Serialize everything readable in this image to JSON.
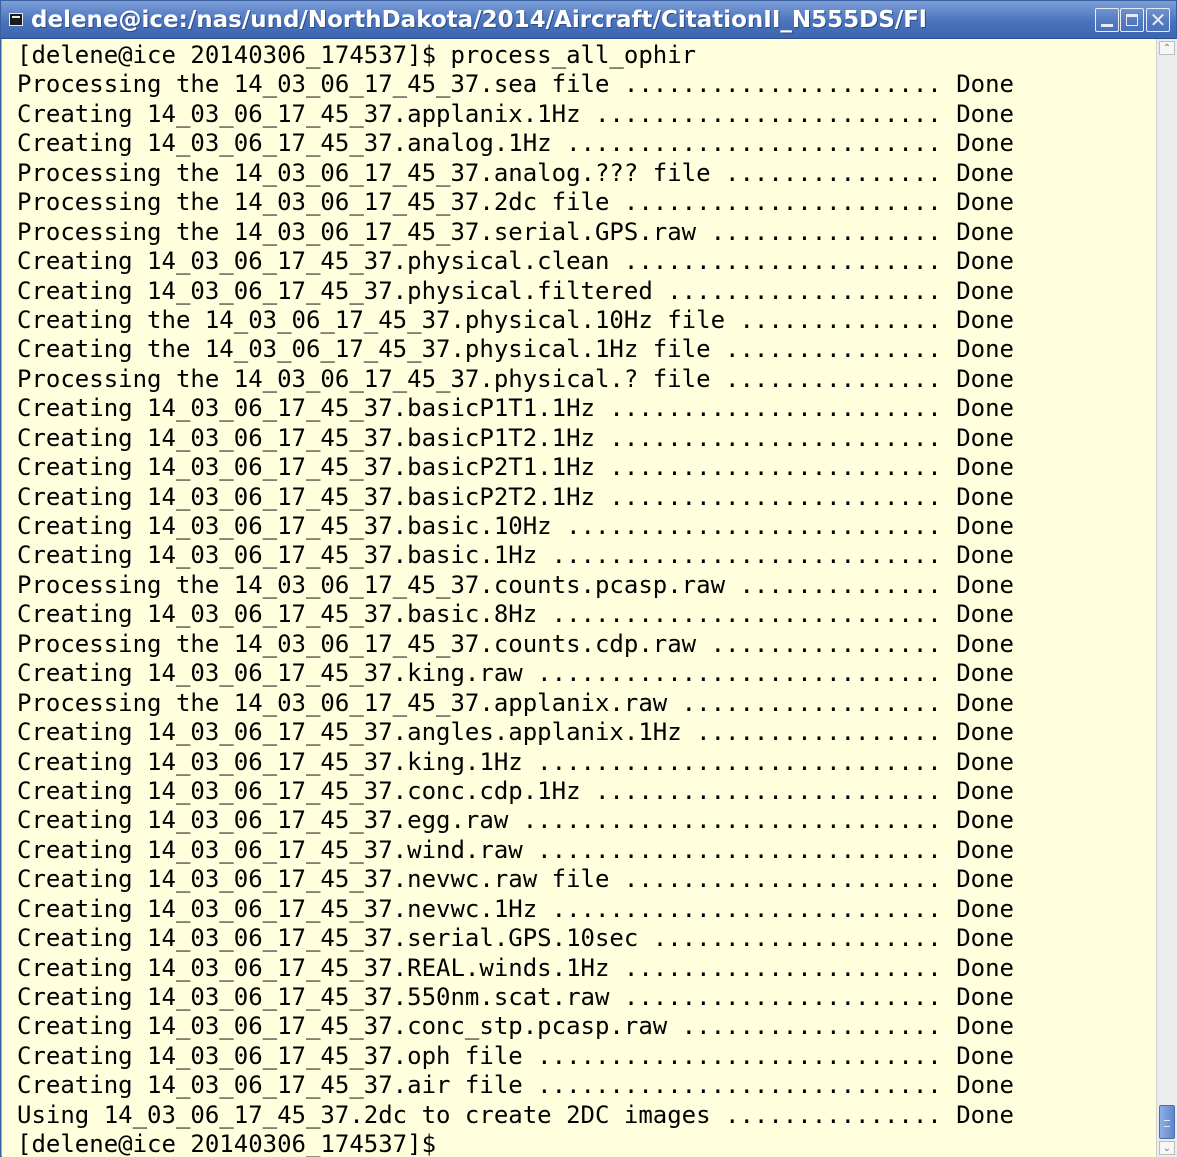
{
  "window": {
    "title": "delene@ice:/nas/und/NorthDakota/2014/Aircraft/CitationII_N555DS/Fl",
    "icon": "terminal-icon",
    "buttons": [
      "minimize-icon",
      "maximize-icon",
      "close-icon"
    ]
  },
  "terminal": {
    "background": "#ffffdd",
    "lines": [
      "[delene@ice 20140306_174537]$ process_all_ophir",
      "Processing the 14_03_06_17_45_37.sea file ...................... Done",
      "Creating 14_03_06_17_45_37.applanix.1Hz ........................ Done",
      "Creating 14_03_06_17_45_37.analog.1Hz .......................... Done",
      "Processing the 14_03_06_17_45_37.analog.??? file ............... Done",
      "Processing the 14_03_06_17_45_37.2dc file ...................... Done",
      "Processing the 14_03_06_17_45_37.serial.GPS.raw ................ Done",
      "Creating 14_03_06_17_45_37.physical.clean ...................... Done",
      "Creating 14_03_06_17_45_37.physical.filtered ................... Done",
      "Creating the 14_03_06_17_45_37.physical.10Hz file .............. Done",
      "Creating the 14_03_06_17_45_37.physical.1Hz file ............... Done",
      "Processing the 14_03_06_17_45_37.physical.? file ............... Done",
      "Creating 14_03_06_17_45_37.basicP1T1.1Hz ....................... Done",
      "Creating 14_03_06_17_45_37.basicP1T2.1Hz ....................... Done",
      "Creating 14_03_06_17_45_37.basicP2T1.1Hz ....................... Done",
      "Creating 14_03_06_17_45_37.basicP2T2.1Hz ....................... Done",
      "Creating 14_03_06_17_45_37.basic.10Hz .......................... Done",
      "Creating 14_03_06_17_45_37.basic.1Hz ........................... Done",
      "Processing the 14_03_06_17_45_37.counts.pcasp.raw .............. Done",
      "Creating 14_03_06_17_45_37.basic.8Hz ........................... Done",
      "Processing the 14_03_06_17_45_37.counts.cdp.raw ................ Done",
      "Creating 14_03_06_17_45_37.king.raw ............................ Done",
      "Processing the 14_03_06_17_45_37.applanix.raw .................. Done",
      "Creating 14_03_06_17_45_37.angles.applanix.1Hz ................. Done",
      "Creating 14_03_06_17_45_37.king.1Hz ............................ Done",
      "Creating 14_03_06_17_45_37.conc.cdp.1Hz ........................ Done",
      "Creating 14_03_06_17_45_37.egg.raw ............................. Done",
      "Creating 14_03_06_17_45_37.wind.raw ............................ Done",
      "Creating 14_03_06_17_45_37.nevwc.raw file ...................... Done",
      "Creating 14_03_06_17_45_37.nevwc.1Hz ........................... Done",
      "Creating 14_03_06_17_45_37.serial.GPS.10sec .................... Done",
      "Creating 14_03_06_17_45_37.REAL.winds.1Hz ...................... Done",
      "Creating 14_03_06_17_45_37.550nm.scat.raw ...................... Done",
      "Creating 14_03_06_17_45_37.conc_stp.pcasp.raw .................. Done",
      "Creating 14_03_06_17_45_37.oph file ............................ Done",
      "Creating 14_03_06_17_45_37.air file ............................ Done",
      "Using 14_03_06_17_45_37.2dc to create 2DC images ............... Done",
      "[delene@ice 20140306_174537]$"
    ]
  },
  "scrollbar": {
    "up_glyph": "⌃",
    "down_glyph": "⌄",
    "position": 1.0
  }
}
